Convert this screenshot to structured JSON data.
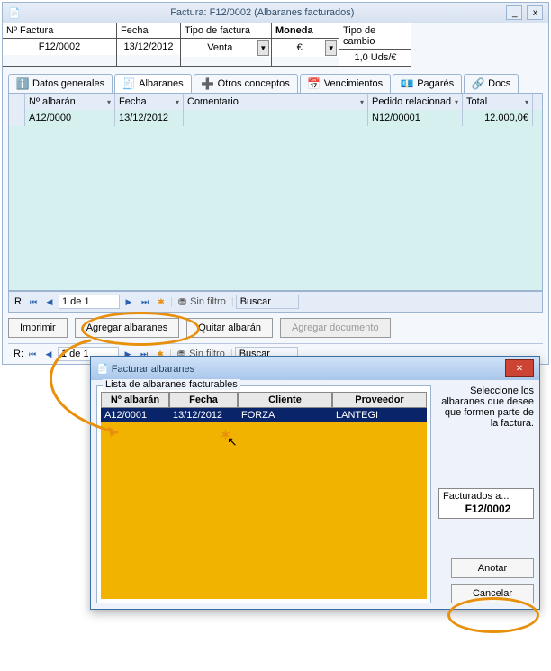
{
  "mainWindow": {
    "title": "Factura: F12/0002 (Albaranes facturados)",
    "header": {
      "nFactura": {
        "label": "Nº Factura",
        "value": "F12/0002"
      },
      "fecha": {
        "label": "Fecha",
        "value": "13/12/2012"
      },
      "tipo": {
        "label": "Tipo de factura",
        "value": "Venta"
      },
      "moneda": {
        "label": "Moneda",
        "value": "€"
      },
      "cambio": {
        "label": "Tipo de cambio",
        "value": "1,0 Uds/€"
      }
    },
    "tabs": {
      "datos": "Datos generales",
      "alb": "Albaranes",
      "otros": "Otros conceptos",
      "venc": "Vencimientos",
      "pag": "Pagarés",
      "docs": "Docs"
    },
    "gridHead": {
      "nAlb": "Nº albarán",
      "fecha": "Fecha",
      "coment": "Comentario",
      "pedido": "Pedido relacionad",
      "total": "Total"
    },
    "gridRow": {
      "nAlb": "A12/0000",
      "fecha": "13/12/2012",
      "coment": "",
      "pedido": "N12/00001",
      "total": "12.000,0€"
    },
    "nav": {
      "recLabel": "R:",
      "recPos": "1 de 1",
      "filterLabel": "Sin filtro",
      "searchPlaceholder": "Buscar"
    },
    "actions": {
      "imprimir": "Imprimir",
      "agregar": "Agregar albaranes",
      "quitar": "Quitar albarán",
      "agregarDoc": "Agregar documento"
    }
  },
  "dialog": {
    "title": "Facturar albaranes",
    "groupTitle": "Lista de albaranes facturables",
    "head": {
      "nAlb": "Nº albarán",
      "fecha": "Fecha",
      "cliente": "Cliente",
      "prov": "Proveedor"
    },
    "row": {
      "nAlb": "A12/0001",
      "fecha": "13/12/2012",
      "cliente": "FORZA",
      "prov": "LANTEGI"
    },
    "hint": "Seleccione los albaranes que desee que formen parte de la factura.",
    "factLabel": "Facturados a...",
    "factValue": "F12/0002",
    "btnAnotar": "Anotar",
    "btnCancelar": "Cancelar"
  }
}
